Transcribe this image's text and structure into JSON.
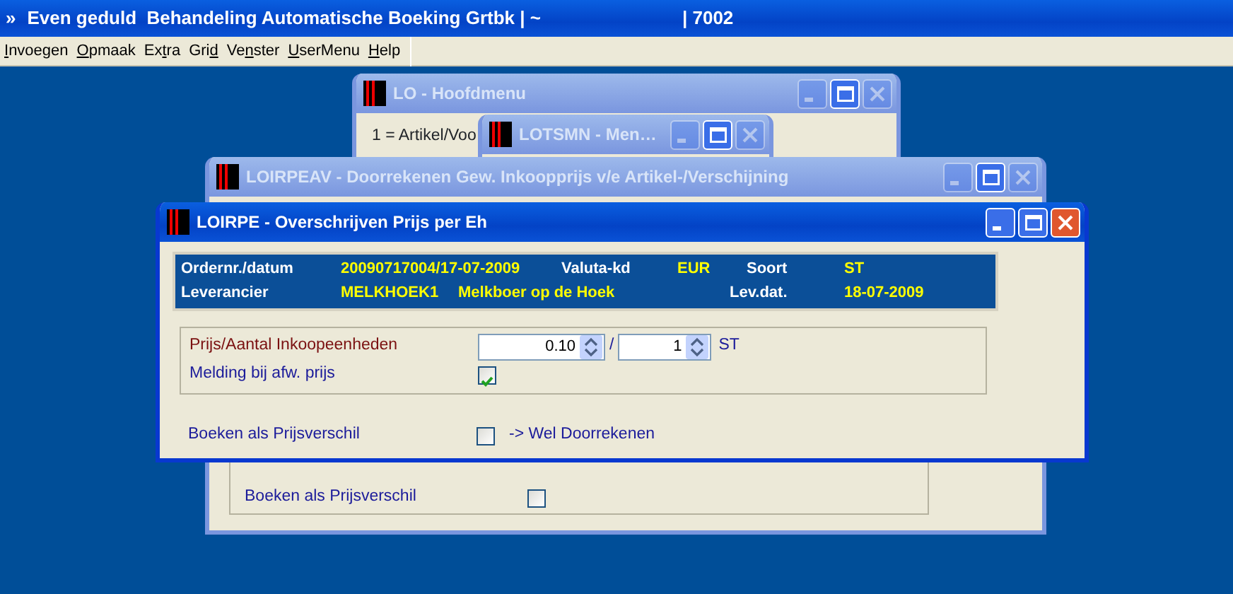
{
  "app_title": {
    "icon": "»",
    "text": "Even geduld  Behandeling Automatische Boeking Grtbk | ~",
    "code": "| 7002"
  },
  "menu": [
    {
      "key": "I",
      "after": "nvoegen"
    },
    {
      "key": "O",
      "after": "pmaak"
    },
    {
      "before": "Ex",
      "key": "t",
      "after": "ra"
    },
    {
      "before": "Gri",
      "key": "d"
    },
    {
      "before": "Ve",
      "key": "n",
      "after": "ster"
    },
    {
      "key": "U",
      "after": "serMenu"
    },
    {
      "key": "H",
      "after": "elp"
    }
  ],
  "main_menu_window": {
    "title": "LO - Hoofdmenu",
    "active": false,
    "lines": [
      "1 = Artikel/Voo"
    ]
  },
  "menu_window": {
    "title": "LOTSMN - Men…",
    "active": false
  },
  "background_dialog": {
    "title": "LOIRPEAV - Doorrekenen Gew. Inkoopprijs v/e Artikel-/Verschijning",
    "active": false,
    "rows": [
      {
        "label": "Boeken als Prijsverschil",
        "checked": false
      }
    ]
  },
  "dialog": {
    "title": "LOIRPE - Overschrijven Prijs per Eh",
    "active": true,
    "header": [
      [
        {
          "text": "Ordernr./datum",
          "kind": "label"
        },
        {
          "text": "20090717004/17-07-2009",
          "kind": "value"
        },
        {
          "text": "Valuta-kd",
          "kind": "label"
        },
        {
          "text": "EUR",
          "kind": "value"
        },
        {
          "text": "Soort",
          "kind": "label"
        },
        {
          "text": "ST",
          "kind": "value"
        }
      ],
      [
        {
          "text": "Leverancier",
          "kind": "label"
        },
        {
          "text": "MELKHOEK1",
          "kind": "value"
        },
        {
          "text": "Melkboer op de Hoek",
          "kind": "value"
        },
        {
          "text": "Lev.dat.",
          "kind": "label"
        },
        {
          "text": "18-07-2009",
          "kind": "value"
        }
      ]
    ],
    "price": {
      "label": "Prijs/Aantal Inkoopeenheden",
      "price": "0.10",
      "separator": "/",
      "quantity": "1",
      "unit": "ST"
    },
    "warn": {
      "label": "Melding bij afw. prijs",
      "checked": true
    },
    "book": {
      "label": "Boeken als Prijsverschil",
      "checked": false,
      "note": "-> Wel Doorrekenen"
    }
  }
}
